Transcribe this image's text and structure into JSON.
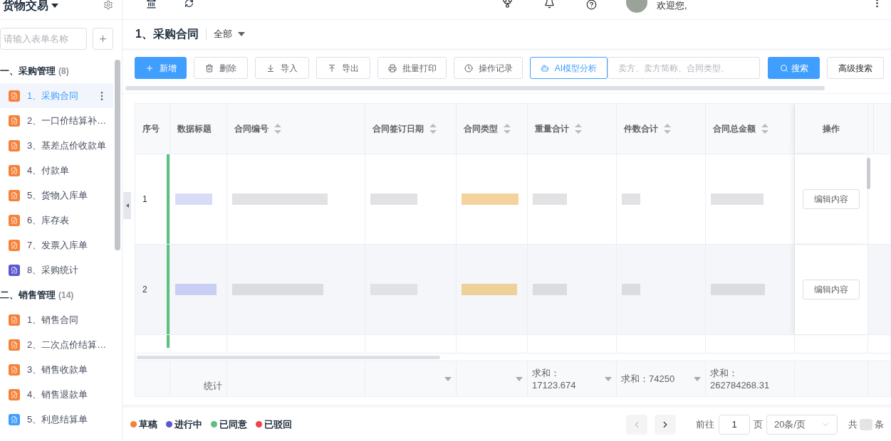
{
  "topbar": {
    "app_title": "货物交易",
    "greeting": "欢迎您,"
  },
  "sidebar": {
    "search": {
      "placeholder": "请输入表单名称"
    },
    "add_button": "+",
    "groups": [
      {
        "label": "一、采购管理",
        "count": "(8)",
        "children": [
          {
            "label": "1、采购合同",
            "color": "#f5813a",
            "selected": true
          },
          {
            "label": "2、一口价结算补…",
            "color": "#f5813a",
            "selected": false
          },
          {
            "label": "3、基差点价收款单",
            "color": "#f5813a",
            "selected": false
          },
          {
            "label": "4、付款单",
            "color": "#f5813a",
            "selected": false
          },
          {
            "label": "5、货物入库单",
            "color": "#f5813a",
            "selected": false
          },
          {
            "label": "6、库存表",
            "color": "#f5813a",
            "selected": false
          },
          {
            "label": "7、发票入库单",
            "color": "#f5813a",
            "selected": false
          },
          {
            "label": "8、采购统计",
            "color": "#5b57d1",
            "selected": false
          }
        ]
      },
      {
        "label": "二、销售管理",
        "count": "(14)",
        "children": [
          {
            "label": "1、销售合同",
            "color": "#f5813a",
            "selected": false
          },
          {
            "label": "2、二次点价结算…",
            "color": "#f5813a",
            "selected": false
          },
          {
            "label": "3、销售收款单",
            "color": "#f5813a",
            "selected": false
          },
          {
            "label": "4、销售退款单",
            "color": "#f5813a",
            "selected": false
          },
          {
            "label": "5、利息结算单",
            "color": "#409eff",
            "selected": false
          }
        ]
      }
    ]
  },
  "page": {
    "title": "1、采购合同",
    "filter": "全部"
  },
  "toolbar": {
    "buttons": [
      {
        "label": "新增",
        "kind": "primary"
      },
      {
        "label": "删除",
        "kind": "default"
      },
      {
        "label": "导入",
        "kind": "default"
      },
      {
        "label": "导出",
        "kind": "default"
      },
      {
        "label": "批量打印",
        "kind": "default"
      },
      {
        "label": "操作记录",
        "kind": "default"
      },
      {
        "label": "AI模型分析",
        "kind": "outline"
      }
    ],
    "search": {
      "placeholder": "卖方、卖方简称、合同类型、"
    },
    "search_button": "搜索",
    "advanced_button": "高级搜索"
  },
  "table": {
    "columns": [
      {
        "label": "序号",
        "sortable": false
      },
      {
        "label": "数据标题",
        "sortable": false
      },
      {
        "label": "合同编号",
        "sortable": true
      },
      {
        "label": "合同签订日期",
        "sortable": true
      },
      {
        "label": "合同类型",
        "sortable": true
      },
      {
        "label": "重量合计",
        "sortable": true
      },
      {
        "label": "件数合计",
        "sortable": true
      },
      {
        "label": "合同总金额",
        "sortable": true
      },
      {
        "label": "操作",
        "sortable": false
      }
    ],
    "rows": [
      {
        "index": "1",
        "color": "#5cc17f",
        "action": "编辑内容"
      },
      {
        "index": "2",
        "color": "#5cc17f",
        "action": "编辑内容"
      },
      {
        "color": "#5cc17f"
      }
    ],
    "summary": [
      {
        "dropdown": false
      },
      {
        "dropdown": false,
        "text": "统计"
      },
      {
        "dropdown": false
      },
      {
        "dropdown": true
      },
      {
        "dropdown": true
      },
      {
        "dropdown": true,
        "text": "求和：17123.674"
      },
      {
        "dropdown": true,
        "text": "求和：74250"
      },
      {
        "dropdown": false,
        "text": "求和：262784268.31"
      },
      {
        "dropdown": false
      }
    ]
  },
  "legend": [
    {
      "label": "草稿",
      "color": "#f5813a"
    },
    {
      "label": "进行中",
      "color": "#5b57d1"
    },
    {
      "label": "已同意",
      "color": "#5cc17f"
    },
    {
      "label": "已驳回",
      "color": "#f0434b"
    }
  ],
  "pagination": {
    "prev_disabled": true,
    "goto_label": "前往",
    "page": "1",
    "page_suffix": "页",
    "page_size": "20条/页",
    "total_prefix": "共",
    "total_suffix": "条"
  }
}
